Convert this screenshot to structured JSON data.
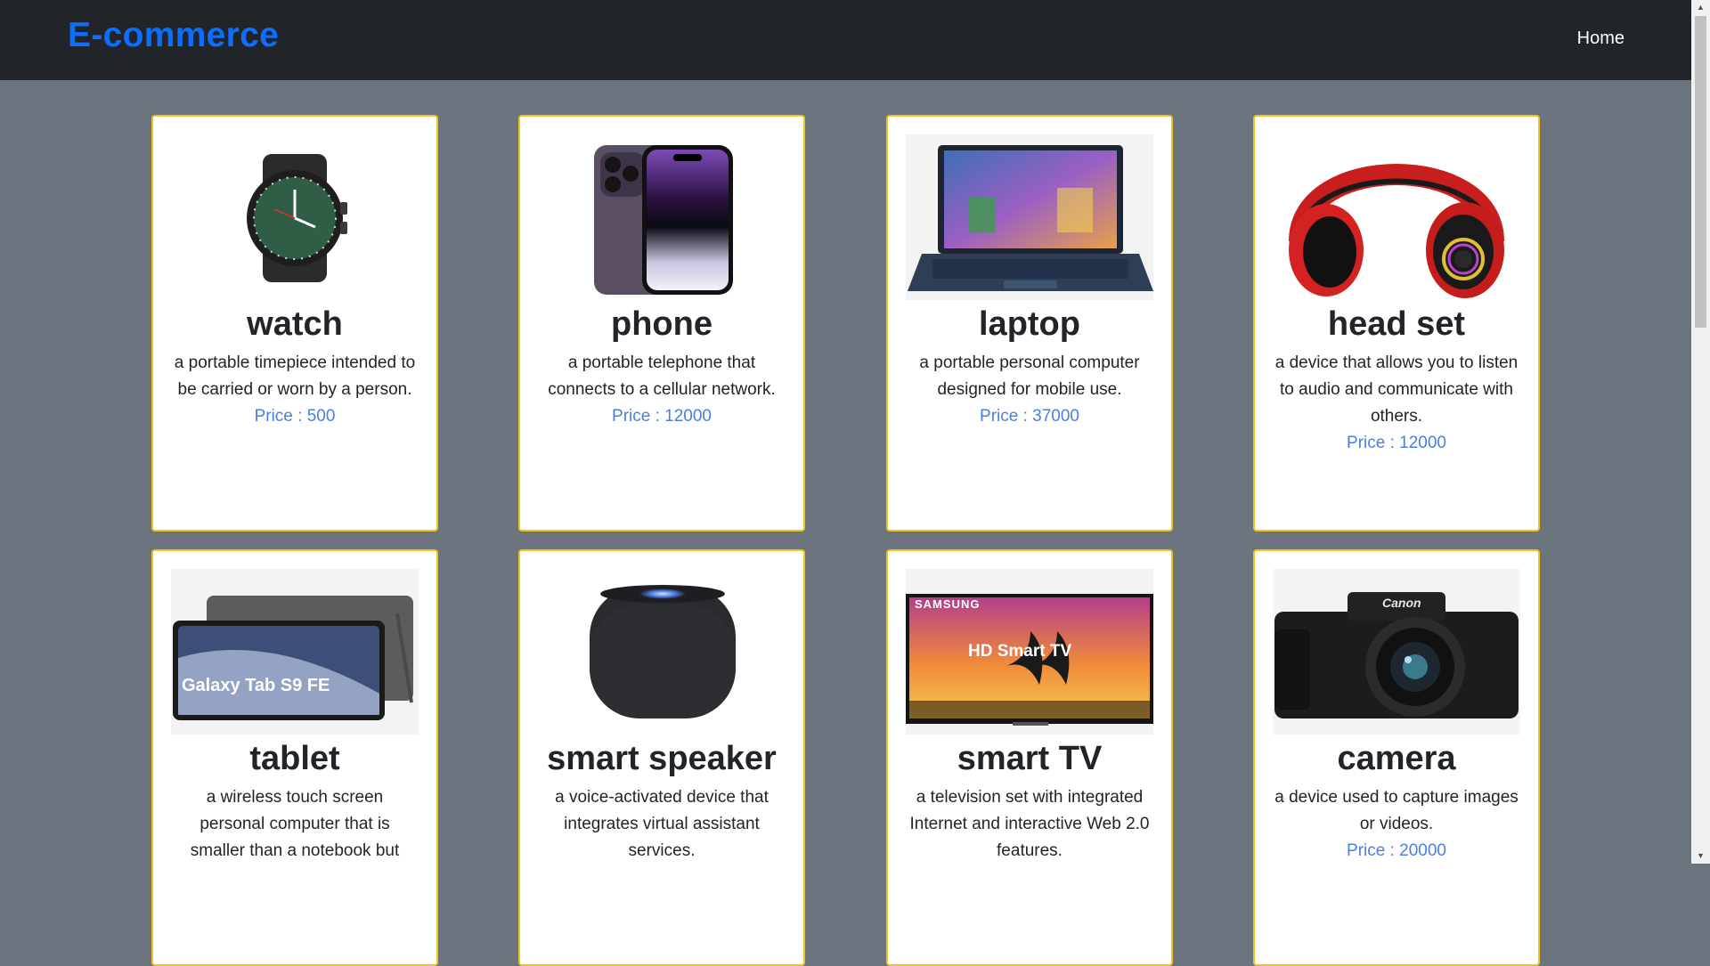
{
  "navbar": {
    "brand": "E-commerce",
    "home_label": "Home"
  },
  "price_prefix": "Price : ",
  "products": [
    {
      "name": "watch",
      "description": "a portable timepiece intended to be carried or worn by a person.",
      "price": "500",
      "image": "smartwatch-icon"
    },
    {
      "name": "phone",
      "description": "a portable telephone that connects to a cellular network.",
      "price": "12000",
      "image": "smartphone-icon"
    },
    {
      "name": "laptop",
      "description": "a portable personal computer designed for mobile use.",
      "price": "37000",
      "image": "laptop-icon"
    },
    {
      "name": "head set",
      "description": "a device that allows you to listen to audio and communicate with others.",
      "price": "12000",
      "image": "headphones-icon"
    },
    {
      "name": "tablet",
      "description": "a wireless touch screen personal computer that is smaller than a notebook but",
      "price": "",
      "image": "tablet-icon",
      "image_text": "Galaxy Tab S9 FE"
    },
    {
      "name": "smart speaker",
      "description": "a voice-activated device that integrates virtual assistant services.",
      "price": "",
      "image": "speaker-icon"
    },
    {
      "name": "smart TV",
      "description": "a television set with integrated Internet and interactive Web 2.0 features.",
      "price": "",
      "image": "tv-icon",
      "image_text": "SAMSUNG",
      "image_text2": "HD Smart TV"
    },
    {
      "name": "camera",
      "description": "a device used to capture images or videos.",
      "price": "20000",
      "image": "camera-icon",
      "image_text": "Canon"
    }
  ],
  "colors": {
    "navbar": "#212529",
    "brand": "#0d6efd",
    "background": "#6c757d",
    "card_border": "#f0c419",
    "price": "#4a7fe0"
  }
}
